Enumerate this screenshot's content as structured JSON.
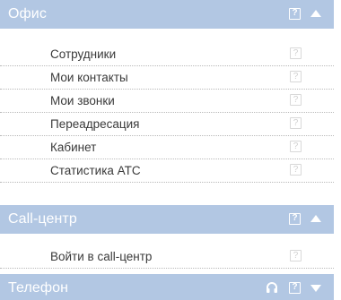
{
  "colors": {
    "header_bg": "#b2c7e3",
    "header_text": "#ffffff",
    "item_text": "#3a3a3a",
    "help_icon_faded": "#d0d0d0",
    "separator": "#b9b9b9"
  },
  "sections": [
    {
      "title": "Офис",
      "help_glyph": "?",
      "toggle_icon": "triangle-up-icon",
      "items": [
        {
          "label": "Сотрудники",
          "help_glyph": "?"
        },
        {
          "label": "Мои контакты",
          "help_glyph": "?"
        },
        {
          "label": "Мои звонки",
          "help_glyph": "?"
        },
        {
          "label": "Переадресация",
          "help_glyph": "?"
        },
        {
          "label": "Кабинет",
          "help_glyph": "?"
        },
        {
          "label": "Статистика АТС",
          "help_glyph": "?"
        }
      ]
    },
    {
      "title": "Call-центр",
      "help_glyph": "?",
      "toggle_icon": "triangle-up-icon",
      "items": [
        {
          "label": "Войти в call-центр",
          "help_glyph": "?"
        }
      ]
    },
    {
      "title": "Телефон",
      "help_glyph": "?",
      "extra_icon": "headset-icon",
      "toggle_icon": "triangle-down-icon",
      "items": []
    }
  ]
}
